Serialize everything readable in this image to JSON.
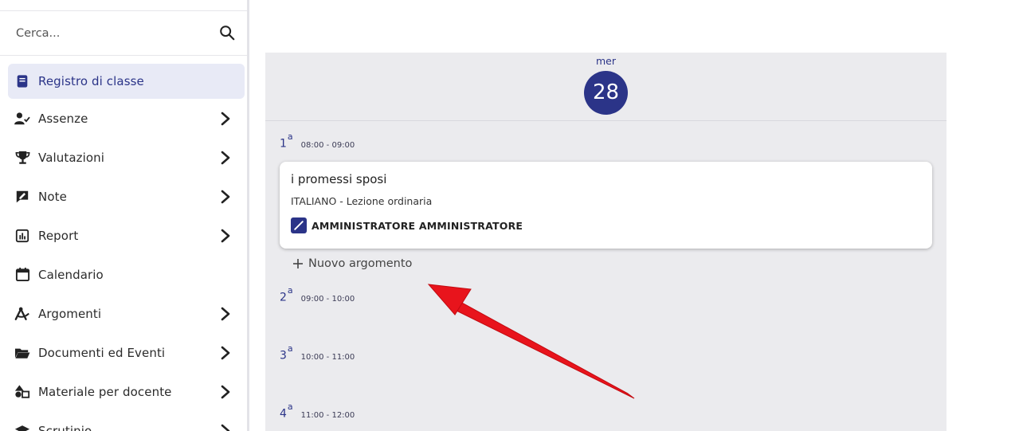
{
  "search": {
    "placeholder": "Cerca..."
  },
  "sidebar": {
    "items": [
      {
        "label": "Registro di classe",
        "icon": "book-icon",
        "active": true,
        "chevron": false
      },
      {
        "label": "Assenze",
        "icon": "user-check-icon",
        "active": false,
        "chevron": true
      },
      {
        "label": "Valutazioni",
        "icon": "trophy-icon",
        "active": false,
        "chevron": true
      },
      {
        "label": "Note",
        "icon": "note-icon",
        "active": false,
        "chevron": true
      },
      {
        "label": "Report",
        "icon": "report-icon",
        "active": false,
        "chevron": true
      },
      {
        "label": "Calendario",
        "icon": "calendar-icon",
        "active": false,
        "chevron": false
      },
      {
        "label": "Argomenti",
        "icon": "compass-icon",
        "active": false,
        "chevron": true
      },
      {
        "label": "Documenti ed Eventi",
        "icon": "folder-icon",
        "active": false,
        "chevron": true
      },
      {
        "label": "Materiale per docente",
        "icon": "shapes-icon",
        "active": false,
        "chevron": true
      },
      {
        "label": "Scrutinio",
        "icon": "graduation-cap-icon",
        "active": false,
        "chevron": true
      }
    ]
  },
  "day": {
    "name": "mer",
    "number": "28",
    "slots": [
      {
        "num": "1",
        "sup": "a",
        "time": "08:00 - 09:00"
      },
      {
        "num": "2",
        "sup": "a",
        "time": "09:00 - 10:00"
      },
      {
        "num": "3",
        "sup": "a",
        "time": "10:00 - 11:00"
      },
      {
        "num": "4",
        "sup": "a",
        "time": "11:00 - 12:00"
      }
    ],
    "lesson": {
      "title": "i promessi sposi",
      "subject": "ITALIANO - Lezione ordinaria",
      "teacher": "AMMINISTRATORE AMMINISTRATORE"
    },
    "new_topic_label": "Nuovo argomento"
  },
  "colors": {
    "accent": "#2b3488",
    "active_bg": "#e8eaf6",
    "day_bg": "#ebebee",
    "arrow": "#e8141c"
  }
}
